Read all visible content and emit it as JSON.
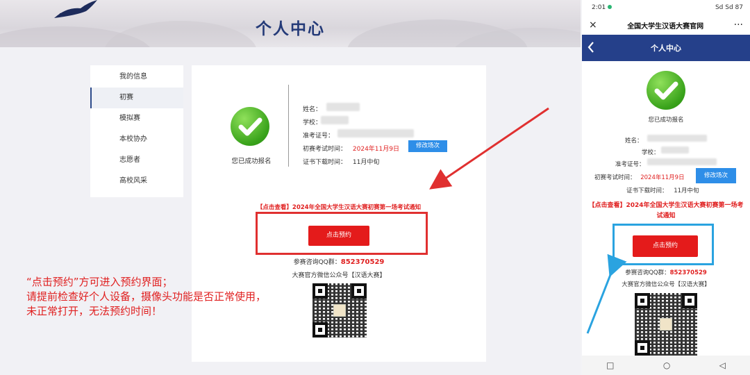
{
  "desktop": {
    "page_title": "个人中心",
    "sidebar": [
      {
        "label": "我的信息"
      },
      {
        "label": "初赛"
      },
      {
        "label": "模拟赛"
      },
      {
        "label": "本校协办"
      },
      {
        "label": "志愿者"
      },
      {
        "label": "高校风采"
      }
    ],
    "success_text": "您已成功报名",
    "info": {
      "name_label": "姓名：",
      "school_label": "学校：",
      "ticket_label": "准考证号：",
      "exam_time_label": "初赛考试时间：",
      "exam_time_value": "2024年11月9日",
      "modify_button": "修改场次",
      "cert_label": "证书下载时间：",
      "cert_value": "11月中旬"
    },
    "notice_link": "【点击查看】2024年全国大学生汉语大赛初赛第一场考试通知",
    "book_button": "点击预约",
    "qq_label": "参赛咨询QQ群：",
    "qq_value": "852370529",
    "wechat_text": "大赛官方微信公众号【汉语大赛】",
    "annotation": [
      "“点击预约”方可进入预约界面；",
      "请提前检查好个人设备，摄像头功能是否正常使用，",
      "未正常打开，无法预约时间！"
    ]
  },
  "phone": {
    "status_time": "2:01",
    "status_icons": "Sd Sd 87",
    "site_title": "全国大学生汉语大赛官网",
    "close_icon": "×",
    "more_icon": "···",
    "header_title": "个人中心",
    "success_text": "您已成功报名",
    "name_label": "姓名：",
    "school_label": "学校：",
    "ticket_label": "准考证号：",
    "exam_time_label": "初赛考试时间：",
    "exam_time_value": "2024年11月9日",
    "modify_button": "修改场次",
    "cert_label": "证书下载时间：",
    "cert_value": "11月中旬",
    "notice_link": "【点击查看】2024年全国大学生汉语大赛初赛第一场考试通知",
    "book_button": "点击预约",
    "qq_label": "参赛咨询QQ群：",
    "qq_value": "852370529",
    "wechat_text": "大赛官方微信公众号【汉语大赛】"
  },
  "colors": {
    "brand_navy": "#25408a",
    "alert_red": "#e02020",
    "button_blue": "#2e8ee8",
    "highlight_blue": "#2aa3e0"
  }
}
